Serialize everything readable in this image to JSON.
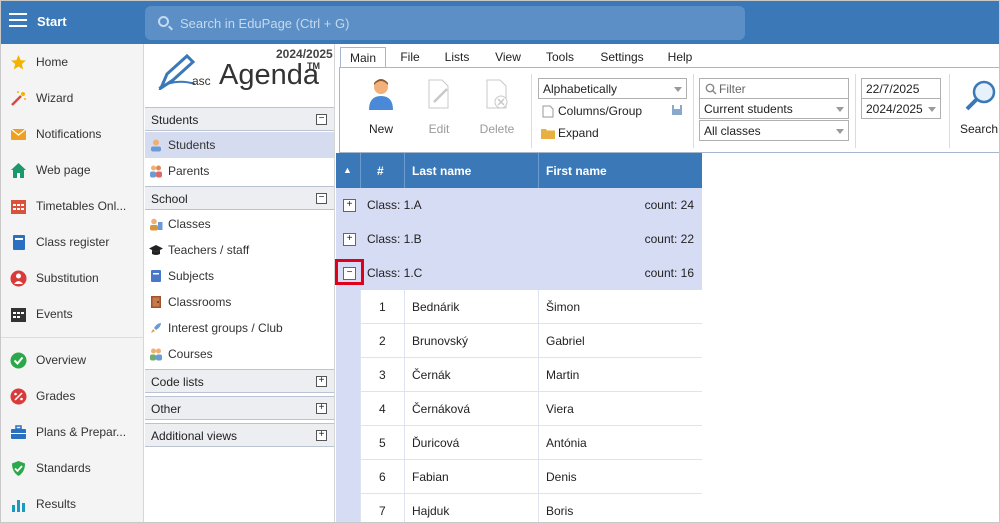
{
  "topbar": {
    "start_label": "Start",
    "search_placeholder": "Search in EduPage (Ctrl + G)"
  },
  "leftnav": [
    {
      "label": "Home",
      "icon": "star-icon",
      "color": "#f2b400"
    },
    {
      "label": "Wizard",
      "icon": "magic-wand-icon",
      "color": "#d94a3a"
    },
    {
      "label": "Notifications",
      "icon": "envelope-icon",
      "color": "#f0a020"
    },
    {
      "label": "Web page",
      "icon": "house-icon",
      "color": "#1a9a6a"
    },
    {
      "label": "Timetables Onl...",
      "icon": "calendar-icon",
      "color": "#d9533c"
    },
    {
      "label": "Class register",
      "icon": "book-icon",
      "color": "#2a6fc0"
    },
    {
      "label": "Substitution",
      "icon": "person-swap-icon",
      "color": "#d93a3a"
    },
    {
      "label": "Events",
      "icon": "events-calendar-icon",
      "color": "#333333"
    },
    {
      "label": "Overview",
      "icon": "check-circle-icon",
      "color": "#2aa84a"
    },
    {
      "label": "Grades",
      "icon": "grades-icon",
      "color": "#d93a3a"
    },
    {
      "label": "Plans & Prepar...",
      "icon": "briefcase-icon",
      "color": "#2a6fc0"
    },
    {
      "label": "Standards",
      "icon": "shield-check-icon",
      "color": "#2aa84a"
    },
    {
      "label": "Results",
      "icon": "bar-chart-icon",
      "color": "#1a9ac0"
    }
  ],
  "logo": {
    "year": "2024/2025",
    "asc": "asc",
    "name": "Agenda",
    "tm": "TM"
  },
  "sections": {
    "students": {
      "title": "Students",
      "toggle": "−",
      "items": [
        "Students",
        "Parents"
      ]
    },
    "school": {
      "title": "School",
      "toggle": "−",
      "items": [
        "Classes",
        "Teachers / staff",
        "Subjects",
        "Classrooms",
        "Interest groups / Club",
        "Courses"
      ]
    },
    "code_lists": {
      "title": "Code lists",
      "toggle": "+"
    },
    "other": {
      "title": "Other",
      "toggle": "+"
    },
    "additional": {
      "title": "Additional views",
      "toggle": "+"
    }
  },
  "tabs": [
    "Main",
    "File",
    "Lists",
    "View",
    "Tools",
    "Settings",
    "Help"
  ],
  "ribbon": {
    "new_label": "New",
    "edit_label": "Edit",
    "delete_label": "Delete",
    "sort_select": "Alphabetically",
    "columns_group": "Columns/Group",
    "expand": "Expand",
    "filter_placeholder": "Filter",
    "students_select": "Current students",
    "classes_select": "All classes",
    "date": "22/7/2025",
    "year_select": "2024/2025",
    "search_label": "Search"
  },
  "grid": {
    "sort_indicator": "▲",
    "headers": {
      "num": "#",
      "last": "Last name",
      "first": "First name"
    },
    "groups": [
      {
        "label": "Class: 1.A",
        "count": "count: 24",
        "toggle": "+"
      },
      {
        "label": "Class: 1.B",
        "count": "count: 22",
        "toggle": "+"
      },
      {
        "label": "Class: 1.C",
        "count": "count: 16",
        "toggle": "−"
      }
    ],
    "rows": [
      {
        "num": "1",
        "last": "Bednárik",
        "first": "Šimon"
      },
      {
        "num": "2",
        "last": "Brunovský",
        "first": "Gabriel"
      },
      {
        "num": "3",
        "last": "Černák",
        "first": "Martin"
      },
      {
        "num": "4",
        "last": "Černáková",
        "first": "Viera"
      },
      {
        "num": "5",
        "last": "Ďuricová",
        "first": "Antónia"
      },
      {
        "num": "6",
        "last": "Fabian",
        "first": "Denis"
      },
      {
        "num": "7",
        "last": "Hajduk",
        "first": "Boris"
      }
    ]
  }
}
